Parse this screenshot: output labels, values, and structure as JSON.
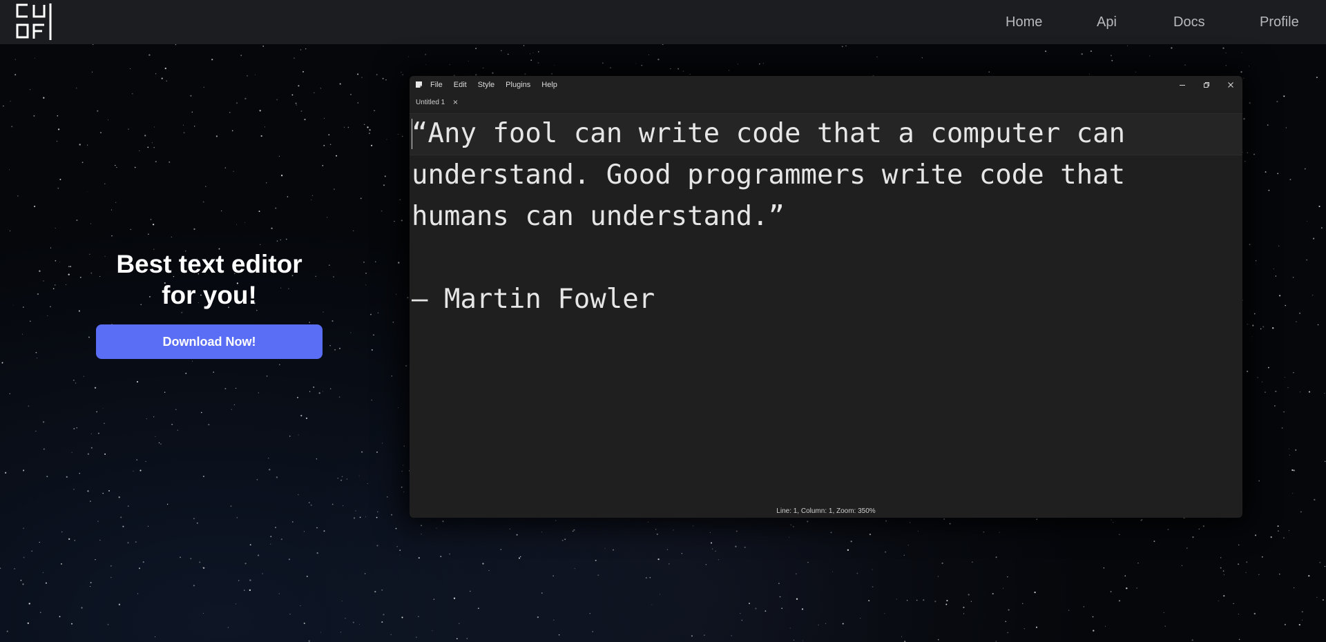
{
  "navbar": {
    "logo_text": "CU OF",
    "links": [
      {
        "label": "Home"
      },
      {
        "label": "Api"
      },
      {
        "label": "Docs"
      },
      {
        "label": "Profile"
      }
    ]
  },
  "hero": {
    "title": "Best text editor for you!",
    "button_label": "Download Now!"
  },
  "editor_window": {
    "menu": [
      "File",
      "Edit",
      "Style",
      "Plugins",
      "Help"
    ],
    "tab": {
      "label": "Untitled 1",
      "close": "×"
    },
    "content": "“Any fool can write code that a computer can\nunderstand. Good programmers write code that\nhumans can understand.”\n\n– Martin Fowler",
    "status": "Line: 1, Column: 1, Zoom: 350%"
  },
  "colors": {
    "navbar_bg": "#1c1d21",
    "button_bg": "#5a6ef5",
    "editor_bg": "#1f1f1f",
    "page_bg": "#05070b"
  },
  "icons": [
    "app-icon",
    "minimize-icon",
    "restore-icon",
    "close-icon",
    "logo"
  ]
}
